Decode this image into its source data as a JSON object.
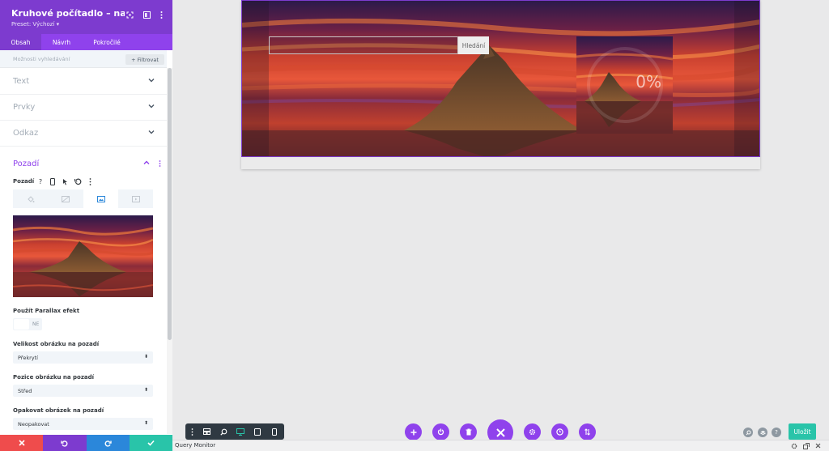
{
  "panel": {
    "title": "Kruhové počítadlo – nastav...",
    "preset": "Preset: Výchozí ▾",
    "tabs": [
      {
        "label": "Obsah",
        "active": true
      },
      {
        "label": "Návrh",
        "active": false
      },
      {
        "label": "Pokročilé",
        "active": false
      }
    ],
    "search_options": "Možnosti vyhledávání",
    "filter_label": "+ Filtrovat",
    "sections": [
      "Text",
      "Prvky",
      "Odkaz",
      "Pozadí"
    ],
    "background": {
      "toolbar_label": "Pozadí",
      "parallax_label": "Použít Parallax efekt",
      "parallax_value": "NE",
      "size_label": "Velikost obrázku na pozadí",
      "size_value": "Překrytí",
      "position_label": "Pozice obrázku na pozadí",
      "position_value": "Střed",
      "repeat_label": "Opakovat obrázek na pozadí",
      "repeat_value": "Neopakovat"
    }
  },
  "canvas": {
    "search_button": "Hledání",
    "counter_value": "0%"
  },
  "bottom_bar": {
    "save_label": "Uložit"
  },
  "query_monitor": {
    "label": "Query Monitor"
  },
  "colors": {
    "accent": "#8f42ec",
    "accent_dark": "#7d3bcf",
    "save": "#29c4a9",
    "discard": "#ef4c4c",
    "undo": "#7d3bcf",
    "redo": "#2b87da",
    "confirm": "#29c4a9"
  }
}
